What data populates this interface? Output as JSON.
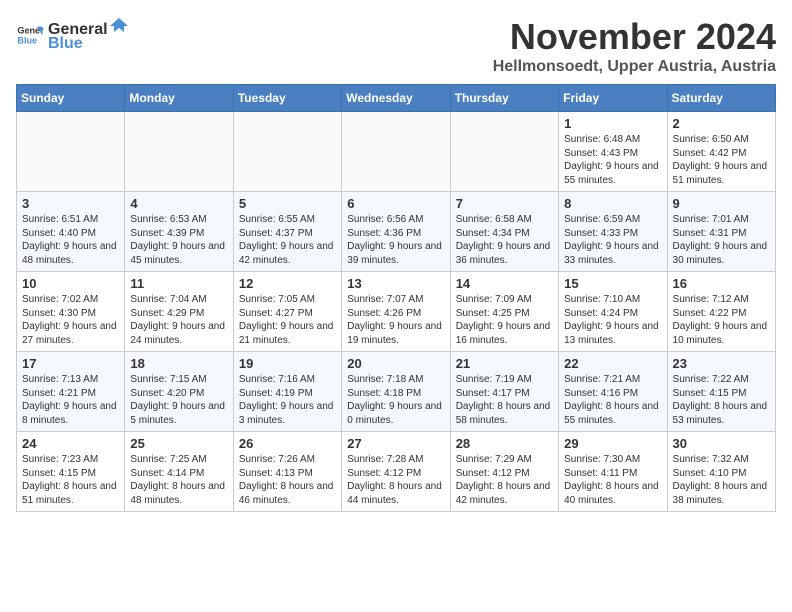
{
  "header": {
    "logo_general": "General",
    "logo_blue": "Blue",
    "month_title": "November 2024",
    "location": "Hellmonsoedt, Upper Austria, Austria"
  },
  "weekdays": [
    "Sunday",
    "Monday",
    "Tuesday",
    "Wednesday",
    "Thursday",
    "Friday",
    "Saturday"
  ],
  "weeks": [
    [
      {
        "day": "",
        "info": ""
      },
      {
        "day": "",
        "info": ""
      },
      {
        "day": "",
        "info": ""
      },
      {
        "day": "",
        "info": ""
      },
      {
        "day": "",
        "info": ""
      },
      {
        "day": "1",
        "info": "Sunrise: 6:48 AM\nSunset: 4:43 PM\nDaylight: 9 hours and 55 minutes."
      },
      {
        "day": "2",
        "info": "Sunrise: 6:50 AM\nSunset: 4:42 PM\nDaylight: 9 hours and 51 minutes."
      }
    ],
    [
      {
        "day": "3",
        "info": "Sunrise: 6:51 AM\nSunset: 4:40 PM\nDaylight: 9 hours and 48 minutes."
      },
      {
        "day": "4",
        "info": "Sunrise: 6:53 AM\nSunset: 4:39 PM\nDaylight: 9 hours and 45 minutes."
      },
      {
        "day": "5",
        "info": "Sunrise: 6:55 AM\nSunset: 4:37 PM\nDaylight: 9 hours and 42 minutes."
      },
      {
        "day": "6",
        "info": "Sunrise: 6:56 AM\nSunset: 4:36 PM\nDaylight: 9 hours and 39 minutes."
      },
      {
        "day": "7",
        "info": "Sunrise: 6:58 AM\nSunset: 4:34 PM\nDaylight: 9 hours and 36 minutes."
      },
      {
        "day": "8",
        "info": "Sunrise: 6:59 AM\nSunset: 4:33 PM\nDaylight: 9 hours and 33 minutes."
      },
      {
        "day": "9",
        "info": "Sunrise: 7:01 AM\nSunset: 4:31 PM\nDaylight: 9 hours and 30 minutes."
      }
    ],
    [
      {
        "day": "10",
        "info": "Sunrise: 7:02 AM\nSunset: 4:30 PM\nDaylight: 9 hours and 27 minutes."
      },
      {
        "day": "11",
        "info": "Sunrise: 7:04 AM\nSunset: 4:29 PM\nDaylight: 9 hours and 24 minutes."
      },
      {
        "day": "12",
        "info": "Sunrise: 7:05 AM\nSunset: 4:27 PM\nDaylight: 9 hours and 21 minutes."
      },
      {
        "day": "13",
        "info": "Sunrise: 7:07 AM\nSunset: 4:26 PM\nDaylight: 9 hours and 19 minutes."
      },
      {
        "day": "14",
        "info": "Sunrise: 7:09 AM\nSunset: 4:25 PM\nDaylight: 9 hours and 16 minutes."
      },
      {
        "day": "15",
        "info": "Sunrise: 7:10 AM\nSunset: 4:24 PM\nDaylight: 9 hours and 13 minutes."
      },
      {
        "day": "16",
        "info": "Sunrise: 7:12 AM\nSunset: 4:22 PM\nDaylight: 9 hours and 10 minutes."
      }
    ],
    [
      {
        "day": "17",
        "info": "Sunrise: 7:13 AM\nSunset: 4:21 PM\nDaylight: 9 hours and 8 minutes."
      },
      {
        "day": "18",
        "info": "Sunrise: 7:15 AM\nSunset: 4:20 PM\nDaylight: 9 hours and 5 minutes."
      },
      {
        "day": "19",
        "info": "Sunrise: 7:16 AM\nSunset: 4:19 PM\nDaylight: 9 hours and 3 minutes."
      },
      {
        "day": "20",
        "info": "Sunrise: 7:18 AM\nSunset: 4:18 PM\nDaylight: 9 hours and 0 minutes."
      },
      {
        "day": "21",
        "info": "Sunrise: 7:19 AM\nSunset: 4:17 PM\nDaylight: 8 hours and 58 minutes."
      },
      {
        "day": "22",
        "info": "Sunrise: 7:21 AM\nSunset: 4:16 PM\nDaylight: 8 hours and 55 minutes."
      },
      {
        "day": "23",
        "info": "Sunrise: 7:22 AM\nSunset: 4:15 PM\nDaylight: 8 hours and 53 minutes."
      }
    ],
    [
      {
        "day": "24",
        "info": "Sunrise: 7:23 AM\nSunset: 4:15 PM\nDaylight: 8 hours and 51 minutes."
      },
      {
        "day": "25",
        "info": "Sunrise: 7:25 AM\nSunset: 4:14 PM\nDaylight: 8 hours and 48 minutes."
      },
      {
        "day": "26",
        "info": "Sunrise: 7:26 AM\nSunset: 4:13 PM\nDaylight: 8 hours and 46 minutes."
      },
      {
        "day": "27",
        "info": "Sunrise: 7:28 AM\nSunset: 4:12 PM\nDaylight: 8 hours and 44 minutes."
      },
      {
        "day": "28",
        "info": "Sunrise: 7:29 AM\nSunset: 4:12 PM\nDaylight: 8 hours and 42 minutes."
      },
      {
        "day": "29",
        "info": "Sunrise: 7:30 AM\nSunset: 4:11 PM\nDaylight: 8 hours and 40 minutes."
      },
      {
        "day": "30",
        "info": "Sunrise: 7:32 AM\nSunset: 4:10 PM\nDaylight: 8 hours and 38 minutes."
      }
    ]
  ]
}
